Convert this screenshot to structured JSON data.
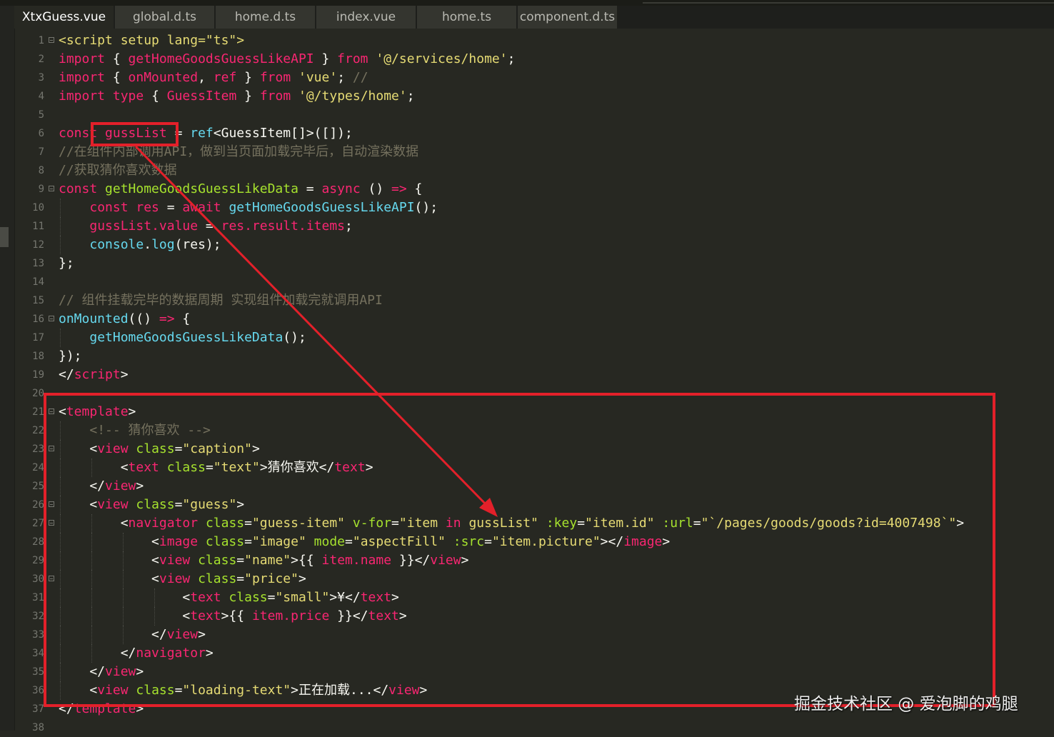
{
  "tabs": [
    {
      "label": "XtxGuess.vue",
      "active": true
    },
    {
      "label": "global.d.ts",
      "active": false
    },
    {
      "label": "home.d.ts",
      "active": false
    },
    {
      "label": "index.vue",
      "active": false
    },
    {
      "label": "home.ts",
      "active": false
    },
    {
      "label": "component.d.ts",
      "active": false
    }
  ],
  "colors": {
    "plain": "#f8f8f2",
    "keyword": "#f92672",
    "tag": "#f92672",
    "attr": "#a6e22e",
    "string": "#e6db74",
    "func": "#66d9ef",
    "type": "#a6e22e",
    "comment": "#75715e",
    "highlight_box": "#e3202a"
  },
  "lines": [
    {
      "num": "1",
      "fold": true,
      "tokens": [
        [
          "<script setup lang=\"ts\">",
          "string"
        ]
      ]
    },
    {
      "num": "2",
      "tokens": [
        [
          "import",
          "keyword"
        ],
        [
          " { ",
          "plain"
        ],
        [
          "getHomeGoodsGuessLikeAPI",
          "keyword"
        ],
        [
          " } ",
          "plain"
        ],
        [
          "from",
          "keyword"
        ],
        [
          " '@/services/home'",
          "string"
        ],
        [
          ";",
          "plain"
        ]
      ]
    },
    {
      "num": "3",
      "tokens": [
        [
          "import",
          "keyword"
        ],
        [
          " { ",
          "plain"
        ],
        [
          "onMounted",
          "keyword"
        ],
        [
          ", ",
          "plain"
        ],
        [
          "ref",
          "keyword"
        ],
        [
          " } ",
          "plain"
        ],
        [
          "from",
          "keyword"
        ],
        [
          " 'vue'",
          "string"
        ],
        [
          ";",
          "plain"
        ],
        [
          " //",
          "comment"
        ]
      ]
    },
    {
      "num": "4",
      "tokens": [
        [
          "import",
          "keyword"
        ],
        [
          " ",
          "plain"
        ],
        [
          "type",
          "keyword"
        ],
        [
          " { ",
          "plain"
        ],
        [
          "GuessItem",
          "keyword"
        ],
        [
          " } ",
          "plain"
        ],
        [
          "from",
          "keyword"
        ],
        [
          " '@/types/home'",
          "string"
        ],
        [
          ";",
          "plain"
        ]
      ]
    },
    {
      "num": "5",
      "tokens": []
    },
    {
      "num": "6",
      "tokens": [
        [
          "const",
          "keyword"
        ],
        [
          " gussList",
          "keyword"
        ],
        [
          " = ",
          "plain"
        ],
        [
          "ref",
          "func"
        ],
        [
          "<",
          "plain"
        ],
        [
          "GuessItem",
          "plain"
        ],
        [
          "[]>([]);",
          "plain"
        ]
      ]
    },
    {
      "num": "7",
      "tokens": [
        [
          "//在组件内部调用API，做到当页面加载完毕后，自动渲染数据",
          "comment"
        ]
      ]
    },
    {
      "num": "8",
      "tokens": [
        [
          "//获取猜你喜欢数据",
          "comment"
        ]
      ]
    },
    {
      "num": "9",
      "fold": true,
      "tokens": [
        [
          "const",
          "keyword"
        ],
        [
          " getHomeGoodsGuessLikeData",
          "attr"
        ],
        [
          " = ",
          "plain"
        ],
        [
          "async",
          "keyword"
        ],
        [
          " () ",
          "plain"
        ],
        [
          "=>",
          "keyword"
        ],
        [
          " {",
          "plain"
        ]
      ]
    },
    {
      "num": "10",
      "guides": [
        0
      ],
      "tokens": [
        [
          "    ",
          "plain"
        ],
        [
          "const",
          "keyword"
        ],
        [
          " res",
          "keyword"
        ],
        [
          " = ",
          "plain"
        ],
        [
          "await",
          "keyword"
        ],
        [
          " ",
          "plain"
        ],
        [
          "getHomeGoodsGuessLikeAPI",
          "func"
        ],
        [
          "();",
          "plain"
        ]
      ]
    },
    {
      "num": "11",
      "guides": [
        0
      ],
      "tokens": [
        [
          "    ",
          "plain"
        ],
        [
          "gussList",
          "keyword"
        ],
        [
          ".value",
          "keyword"
        ],
        [
          " = ",
          "plain"
        ],
        [
          "res",
          "keyword"
        ],
        [
          ".result",
          "keyword"
        ],
        [
          ".items",
          "keyword"
        ],
        [
          ";",
          "plain"
        ]
      ]
    },
    {
      "num": "12",
      "guides": [
        0
      ],
      "tokens": [
        [
          "    ",
          "plain"
        ],
        [
          "console",
          "func"
        ],
        [
          ".",
          "plain"
        ],
        [
          "log",
          "func"
        ],
        [
          "(res);",
          "plain"
        ]
      ]
    },
    {
      "num": "13",
      "tokens": [
        [
          "};",
          "plain"
        ]
      ]
    },
    {
      "num": "14",
      "tokens": []
    },
    {
      "num": "15",
      "tokens": [
        [
          "// 组件挂载完毕的数据周期 实现组件加载完就调用API",
          "comment"
        ]
      ]
    },
    {
      "num": "16",
      "fold": true,
      "tokens": [
        [
          "onMounted",
          "func"
        ],
        [
          "(() ",
          "plain"
        ],
        [
          "=>",
          "keyword"
        ],
        [
          " {",
          "plain"
        ]
      ]
    },
    {
      "num": "17",
      "guides": [
        0
      ],
      "tokens": [
        [
          "    ",
          "plain"
        ],
        [
          "getHomeGoodsGuessLikeData",
          "func"
        ],
        [
          "();",
          "plain"
        ]
      ]
    },
    {
      "num": "18",
      "tokens": [
        [
          "});",
          "plain"
        ]
      ]
    },
    {
      "num": "19",
      "tokens": [
        [
          "</",
          "plain"
        ],
        [
          "script",
          "tag"
        ],
        [
          ">",
          "plain"
        ]
      ]
    },
    {
      "num": "20",
      "tokens": []
    },
    {
      "num": "21",
      "fold": true,
      "tokens": [
        [
          "<",
          "plain"
        ],
        [
          "template",
          "tag"
        ],
        [
          ">",
          "plain"
        ]
      ]
    },
    {
      "num": "22",
      "guides": [
        0
      ],
      "tokens": [
        [
          "    ",
          "plain"
        ],
        [
          "<!-- 猜你喜欢 -->",
          "comment"
        ]
      ]
    },
    {
      "num": "23",
      "fold": true,
      "guides": [
        0
      ],
      "tokens": [
        [
          "    <",
          "plain"
        ],
        [
          "view",
          "tag"
        ],
        [
          " ",
          "plain"
        ],
        [
          "class",
          "attr"
        ],
        [
          "=",
          "plain"
        ],
        [
          "\"caption\"",
          "string"
        ],
        [
          ">",
          "plain"
        ]
      ]
    },
    {
      "num": "24",
      "guides": [
        0,
        1
      ],
      "tokens": [
        [
          "        <",
          "plain"
        ],
        [
          "text",
          "tag"
        ],
        [
          " ",
          "plain"
        ],
        [
          "class",
          "attr"
        ],
        [
          "=",
          "plain"
        ],
        [
          "\"text\"",
          "string"
        ],
        [
          ">猜你喜欢</",
          "plain"
        ],
        [
          "text",
          "tag"
        ],
        [
          ">",
          "plain"
        ]
      ]
    },
    {
      "num": "25",
      "guides": [
        0
      ],
      "tokens": [
        [
          "    </",
          "plain"
        ],
        [
          "view",
          "tag"
        ],
        [
          ">",
          "plain"
        ]
      ]
    },
    {
      "num": "26",
      "fold": true,
      "guides": [
        0
      ],
      "tokens": [
        [
          "    <",
          "plain"
        ],
        [
          "view",
          "tag"
        ],
        [
          " ",
          "plain"
        ],
        [
          "class",
          "attr"
        ],
        [
          "=",
          "plain"
        ],
        [
          "\"guess\"",
          "string"
        ],
        [
          ">",
          "plain"
        ]
      ]
    },
    {
      "num": "27",
      "fold": true,
      "guides": [
        0,
        1
      ],
      "tokens": [
        [
          "        <",
          "plain"
        ],
        [
          "navigator",
          "tag"
        ],
        [
          " ",
          "plain"
        ],
        [
          "class",
          "attr"
        ],
        [
          "=",
          "plain"
        ],
        [
          "\"guess-item\"",
          "string"
        ],
        [
          " ",
          "plain"
        ],
        [
          "v-for",
          "attr"
        ],
        [
          "=",
          "plain"
        ],
        [
          "\"item ",
          "string"
        ],
        [
          "in",
          "keyword"
        ],
        [
          " gussList\"",
          "string"
        ],
        [
          " ",
          "plain"
        ],
        [
          ":key",
          "attr"
        ],
        [
          "=",
          "plain"
        ],
        [
          "\"item.id\"",
          "string"
        ],
        [
          " ",
          "plain"
        ],
        [
          ":url",
          "attr"
        ],
        [
          "=",
          "plain"
        ],
        [
          "\"`/pages/goods/goods?id=4007498`\"",
          "string"
        ],
        [
          ">",
          "plain"
        ]
      ]
    },
    {
      "num": "28",
      "guides": [
        0,
        1,
        2
      ],
      "tokens": [
        [
          "            <",
          "plain"
        ],
        [
          "image",
          "tag"
        ],
        [
          " ",
          "plain"
        ],
        [
          "class",
          "attr"
        ],
        [
          "=",
          "plain"
        ],
        [
          "\"image\"",
          "string"
        ],
        [
          " ",
          "plain"
        ],
        [
          "mode",
          "attr"
        ],
        [
          "=",
          "plain"
        ],
        [
          "\"aspectFill\"",
          "string"
        ],
        [
          " ",
          "plain"
        ],
        [
          ":src",
          "attr"
        ],
        [
          "=",
          "plain"
        ],
        [
          "\"item.picture\"",
          "string"
        ],
        [
          "></",
          "plain"
        ],
        [
          "image",
          "tag"
        ],
        [
          ">",
          "plain"
        ]
      ]
    },
    {
      "num": "29",
      "guides": [
        0,
        1,
        2
      ],
      "tokens": [
        [
          "            <",
          "plain"
        ],
        [
          "view",
          "tag"
        ],
        [
          " ",
          "plain"
        ],
        [
          "class",
          "attr"
        ],
        [
          "=",
          "plain"
        ],
        [
          "\"name\"",
          "string"
        ],
        [
          ">{{ ",
          "plain"
        ],
        [
          "item.name",
          "keyword"
        ],
        [
          " }}</",
          "plain"
        ],
        [
          "view",
          "tag"
        ],
        [
          ">",
          "plain"
        ]
      ]
    },
    {
      "num": "30",
      "fold": true,
      "guides": [
        0,
        1,
        2
      ],
      "tokens": [
        [
          "            <",
          "plain"
        ],
        [
          "view",
          "tag"
        ],
        [
          " ",
          "plain"
        ],
        [
          "class",
          "attr"
        ],
        [
          "=",
          "plain"
        ],
        [
          "\"price\"",
          "string"
        ],
        [
          ">",
          "plain"
        ]
      ]
    },
    {
      "num": "31",
      "guides": [
        0,
        1,
        2,
        3
      ],
      "tokens": [
        [
          "                <",
          "plain"
        ],
        [
          "text",
          "tag"
        ],
        [
          " ",
          "plain"
        ],
        [
          "class",
          "attr"
        ],
        [
          "=",
          "plain"
        ],
        [
          "\"small\"",
          "string"
        ],
        [
          ">¥</",
          "plain"
        ],
        [
          "text",
          "tag"
        ],
        [
          ">",
          "plain"
        ]
      ]
    },
    {
      "num": "32",
      "guides": [
        0,
        1,
        2,
        3
      ],
      "tokens": [
        [
          "                <",
          "plain"
        ],
        [
          "text",
          "tag"
        ],
        [
          ">{{ ",
          "plain"
        ],
        [
          "item.price",
          "keyword"
        ],
        [
          " }}</",
          "plain"
        ],
        [
          "text",
          "tag"
        ],
        [
          ">",
          "plain"
        ]
      ]
    },
    {
      "num": "33",
      "guides": [
        0,
        1,
        2
      ],
      "tokens": [
        [
          "            </",
          "plain"
        ],
        [
          "view",
          "tag"
        ],
        [
          ">",
          "plain"
        ]
      ]
    },
    {
      "num": "34",
      "guides": [
        0,
        1
      ],
      "tokens": [
        [
          "        </",
          "plain"
        ],
        [
          "navigator",
          "tag"
        ],
        [
          ">",
          "plain"
        ]
      ]
    },
    {
      "num": "35",
      "guides": [
        0
      ],
      "tokens": [
        [
          "    </",
          "plain"
        ],
        [
          "view",
          "tag"
        ],
        [
          ">",
          "plain"
        ]
      ]
    },
    {
      "num": "36",
      "guides": [
        0
      ],
      "tokens": [
        [
          "    <",
          "plain"
        ],
        [
          "view",
          "tag"
        ],
        [
          " ",
          "plain"
        ],
        [
          "class",
          "attr"
        ],
        [
          "=",
          "plain"
        ],
        [
          "\"loading-text\"",
          "string"
        ],
        [
          ">正在加载...</",
          "plain"
        ],
        [
          "view",
          "tag"
        ],
        [
          ">",
          "plain"
        ]
      ]
    },
    {
      "num": "37",
      "tokens": [
        [
          "</",
          "plain"
        ],
        [
          "template",
          "tag"
        ],
        [
          ">",
          "plain"
        ]
      ]
    },
    {
      "num": "38",
      "tokens": []
    }
  ],
  "annotations": {
    "arrow_label": "gussList reference arrow"
  },
  "watermark": "掘金技术社区 @ 爱泡脚的鸡腿"
}
